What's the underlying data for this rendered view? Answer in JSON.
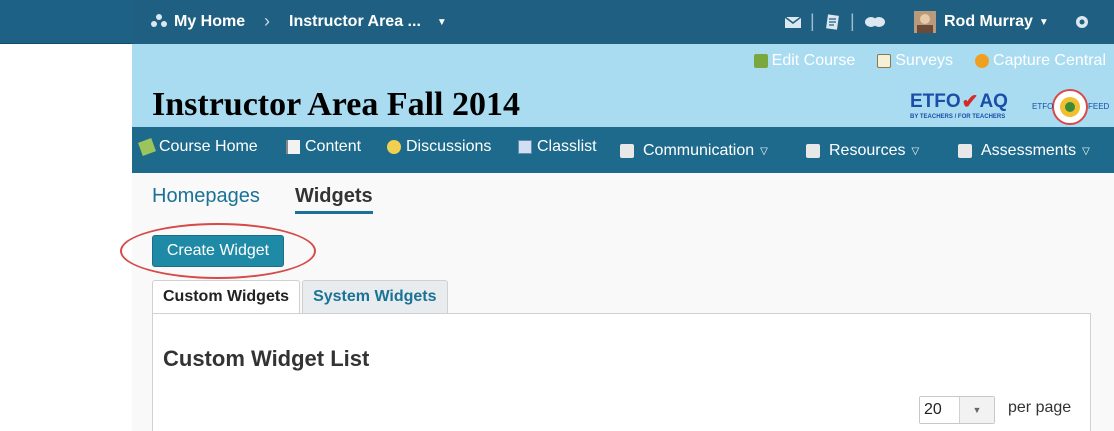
{
  "topbar": {
    "home_label": "My Home",
    "breadcrumb_sep": "›",
    "course_label": "Instructor Area ...",
    "user_name": "Rod Murray"
  },
  "banner": {
    "links": [
      {
        "label": "Edit Course",
        "icon": "edit-course-icon"
      },
      {
        "label": "Surveys",
        "icon": "clipboard-icon"
      },
      {
        "label": "Capture Central",
        "icon": "capture-icon"
      }
    ],
    "course_title": "Instructor Area Fall 2014",
    "etfo_logo_text": "ETFO",
    "aq_logo_text": "AQ",
    "etfo_tagline": "BY TEACHERS / FOR TEACHERS",
    "feed_logo_left": "ETFO",
    "feed_logo_right": "FEED"
  },
  "nav": {
    "items": [
      {
        "label": "Course Home",
        "icon": "course-home-icon"
      },
      {
        "label": "Content",
        "icon": "book-icon"
      },
      {
        "label": "Discussions",
        "icon": "discussions-icon"
      },
      {
        "label": "Classlist",
        "icon": "classlist-icon"
      },
      {
        "label": "Communication",
        "icon": "communication-icon",
        "dropdown": true
      },
      {
        "label": "Resources",
        "icon": "resources-icon",
        "dropdown": true
      },
      {
        "label": "Assessments",
        "icon": "assessments-icon",
        "dropdown": true
      }
    ]
  },
  "page": {
    "subtabs": [
      "Homepages",
      "Widgets"
    ],
    "create_button": "Create Widget",
    "tabs": [
      "Custom Widgets",
      "System Widgets"
    ],
    "panel_title": "Custom Widget List",
    "per_page_value": "20",
    "per_page_label": "per page"
  },
  "colors": {
    "topbar": "#1f5f82",
    "banner": "#a9dcf1",
    "navbar": "#1e6a8c",
    "accent": "#1b7296",
    "button": "#1f8aa6",
    "highlight": "#d64a4a"
  }
}
